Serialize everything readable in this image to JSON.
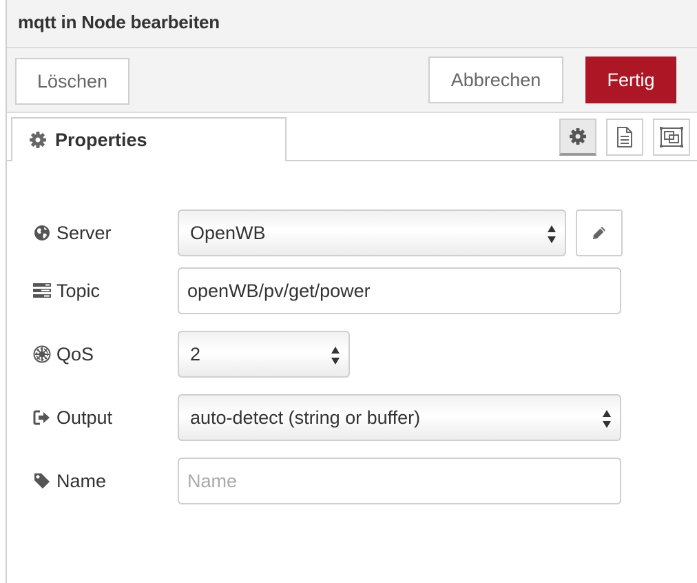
{
  "header": {
    "title": "mqtt in Node bearbeiten"
  },
  "toolbar": {
    "delete_label": "Löschen",
    "cancel_label": "Abbrechen",
    "done_label": "Fertig"
  },
  "tabs": {
    "active_label": "Properties",
    "icons": [
      "gear-icon",
      "document-icon",
      "layout-icon"
    ]
  },
  "form": {
    "server": {
      "label": "Server",
      "value": "OpenWB",
      "icon": "globe-icon"
    },
    "topic": {
      "label": "Topic",
      "value": "openWB/pv/get/power",
      "icon": "tasks-icon"
    },
    "qos": {
      "label": "QoS",
      "value": "2",
      "icon": "empire-icon"
    },
    "output": {
      "label": "Output",
      "value": "auto-detect (string or buffer)",
      "icon": "sign-out-icon"
    },
    "name": {
      "label": "Name",
      "value": "",
      "placeholder": "Name",
      "icon": "tag-icon"
    }
  },
  "colors": {
    "primary": "#ad1625",
    "border": "#cfcfcf",
    "header_bg": "#f3f3f3"
  }
}
